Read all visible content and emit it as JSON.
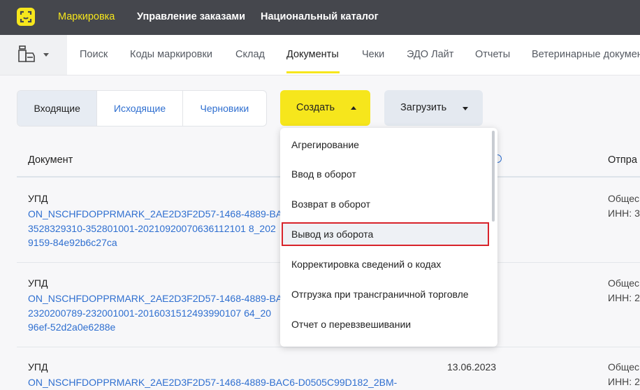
{
  "topnav": {
    "items": [
      {
        "label": "Маркировка",
        "active": true
      },
      {
        "label": "Управление заказами",
        "active": false
      },
      {
        "label": "Национальный каталог",
        "active": false
      }
    ]
  },
  "subnav": {
    "items": [
      "Поиск",
      "Коды маркировки",
      "Склад",
      "Документы",
      "Чеки",
      "ЭДО Лайт",
      "Отчеты",
      "Ветеринарные докумен"
    ],
    "active": "Документы"
  },
  "tabs": {
    "items": [
      "Входящие",
      "Исходящие",
      "Черновики"
    ],
    "active": "Входящие"
  },
  "actions": {
    "create_label": "Создать",
    "load_label": "Загрузить"
  },
  "table": {
    "columns": {
      "document": "Документ",
      "sender": "Отпра"
    },
    "rows": [
      {
        "type": "УПД",
        "link_lines": [
          "ON_NSCHFDOPPRMARK_2AE2D3F2D57-1468-4889-BA",
          "3528329310-352801001-20210920070636112101 8_202",
          "9159-84e92b6c27ca"
        ],
        "date": "",
        "sender_lines": [
          "Общес",
          "ИНН: 3"
        ]
      },
      {
        "type": "УПД",
        "link_lines": [
          "ON_NSCHFDOPPRMARK_2AE2D3F2D57-1468-4889-BA",
          "2320200789-232001001-2016031512493990107 64_20",
          "96ef-52d2a0e6288e"
        ],
        "date": "",
        "sender_lines": [
          "Общес",
          "ИНН: 2"
        ]
      },
      {
        "type": "УПД",
        "link_lines": [
          "ON_NSCHFDOPPRMARK_2AE2D3F2D57-1468-4889-BAC6-D0505C99D182_2BM-"
        ],
        "date": "13.06.2023",
        "sender_lines": [
          "Общес",
          "ИНН: 2"
        ]
      }
    ]
  },
  "dropdown": {
    "items": [
      "Агрегирование",
      "Ввод в оборот",
      "Возврат в оборот",
      "Вывод из оборота",
      "Корректировка сведений о кодах",
      "Отгрузка при трансграничной торговле",
      "Отчет о перевзвешивании"
    ],
    "highlighted": "Вывод из оборота"
  },
  "colors": {
    "topbar": "#45474d",
    "brand_yellow": "#f6e61c",
    "link_blue": "#2f6fd0",
    "highlight_red": "#d8232a"
  }
}
